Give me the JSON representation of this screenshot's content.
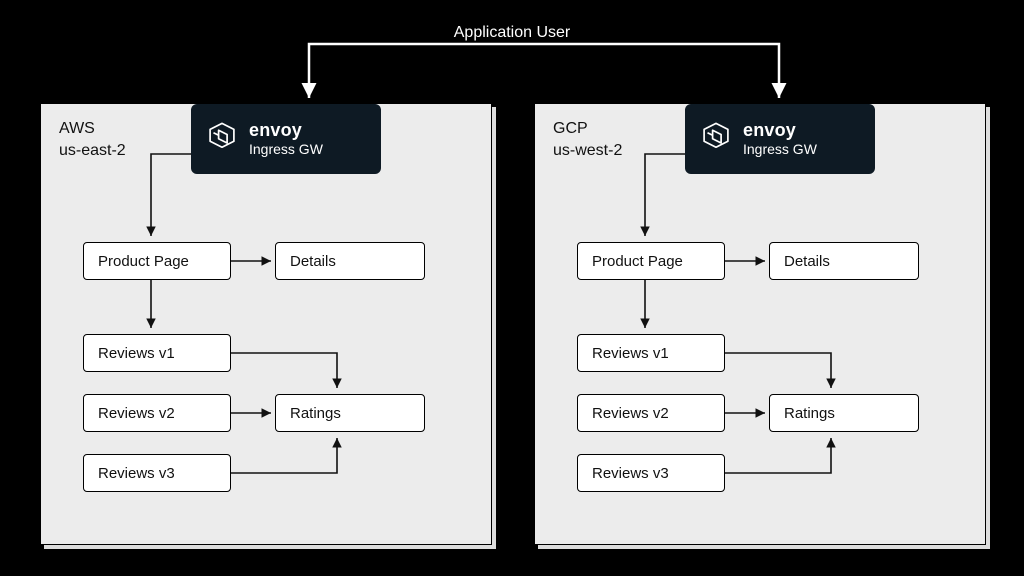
{
  "topology": {
    "user_label": "Application User",
    "envoy": {
      "name": "envoy",
      "subtitle": "Ingress GW"
    },
    "clusters": [
      {
        "provider": "AWS",
        "region": "us-east-2"
      },
      {
        "provider": "GCP",
        "region": "us-west-2"
      }
    ],
    "services": {
      "product_page": "Product Page",
      "details": "Details",
      "reviews_v1": "Reviews v1",
      "reviews_v2": "Reviews v2",
      "reviews_v3": "Reviews v3",
      "ratings": "Ratings"
    },
    "edges_description": "Application User forks to both clusters' envoy Ingress GW. In each cluster: Ingress GW → Product Page. Product Page → Details. Product Page → Reviews v1 / v2 / v3 (shown via a single downward arrow to the reviews column). Reviews v1, v2, v3 → Ratings."
  },
  "colors": {
    "background": "#000000",
    "panel": "#ececec",
    "envoy_box": "#0e1a24",
    "text_light": "#ffffff",
    "stroke": "#000000"
  }
}
